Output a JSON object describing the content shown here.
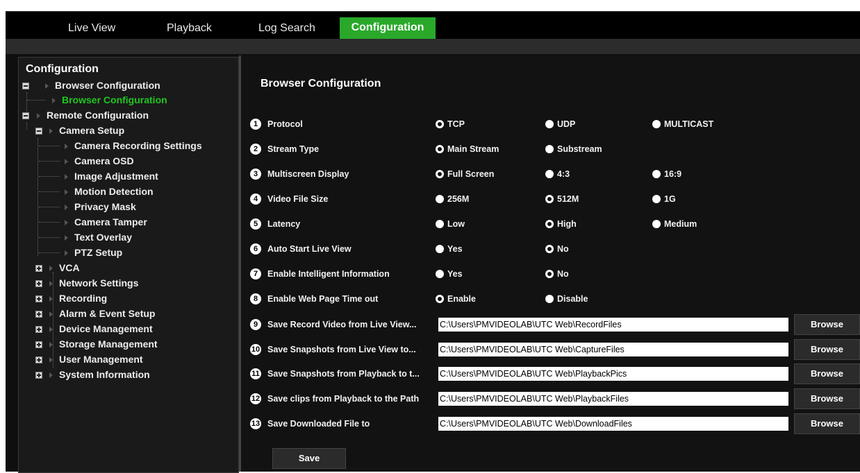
{
  "tabs": [
    {
      "label": "Live View"
    },
    {
      "label": "Playback"
    },
    {
      "label": "Log Search"
    },
    {
      "label": "Configuration",
      "active": true
    }
  ],
  "sidebar": {
    "title": "Configuration",
    "items": [
      {
        "label": "Browser Configuration",
        "expander": "minus"
      },
      {
        "label": "Browser Configuration",
        "selected": true
      },
      {
        "label": "Remote Configuration",
        "expander": "minus"
      },
      {
        "label": "Camera Setup",
        "expander": "minus"
      },
      {
        "label": "Camera Recording Settings"
      },
      {
        "label": "Camera OSD"
      },
      {
        "label": "Image Adjustment"
      },
      {
        "label": "Motion Detection"
      },
      {
        "label": "Privacy Mask"
      },
      {
        "label": "Camera Tamper"
      },
      {
        "label": "Text Overlay"
      },
      {
        "label": "PTZ Setup"
      },
      {
        "label": "VCA",
        "expander": "plus"
      },
      {
        "label": "Network Settings",
        "expander": "plus"
      },
      {
        "label": "Recording",
        "expander": "plus"
      },
      {
        "label": "Alarm & Event Setup",
        "expander": "plus"
      },
      {
        "label": "Device Management",
        "expander": "plus"
      },
      {
        "label": "Storage Management",
        "expander": "plus"
      },
      {
        "label": "User Management",
        "expander": "plus"
      },
      {
        "label": "System Information",
        "expander": "plus"
      }
    ]
  },
  "main": {
    "title": "Browser Configuration",
    "settings": [
      {
        "num": "1",
        "label": "Protocol",
        "options": [
          {
            "label": "TCP",
            "selected": true
          },
          {
            "label": "UDP"
          },
          {
            "label": "MULTICAST"
          }
        ]
      },
      {
        "num": "2",
        "label": "Stream Type",
        "options": [
          {
            "label": "Main Stream",
            "selected": true
          },
          {
            "label": "Substream"
          }
        ]
      },
      {
        "num": "3",
        "label": "Multiscreen Display",
        "options": [
          {
            "label": "Full Screen",
            "selected": true
          },
          {
            "label": "4:3"
          },
          {
            "label": "16:9"
          }
        ]
      },
      {
        "num": "4",
        "label": "Video File Size",
        "options": [
          {
            "label": "256M"
          },
          {
            "label": "512M",
            "selected": true
          },
          {
            "label": "1G"
          }
        ]
      },
      {
        "num": "5",
        "label": "Latency",
        "options": [
          {
            "label": "Low"
          },
          {
            "label": "High",
            "selected": true
          },
          {
            "label": "Medium"
          }
        ]
      },
      {
        "num": "6",
        "label": "Auto Start Live View",
        "options": [
          {
            "label": "Yes"
          },
          {
            "label": "No",
            "selected": true
          }
        ]
      },
      {
        "num": "7",
        "label": "Enable Intelligent Information",
        "options": [
          {
            "label": "Yes"
          },
          {
            "label": "No",
            "selected": true
          }
        ]
      },
      {
        "num": "8",
        "label": "Enable Web Page Time out",
        "options": [
          {
            "label": "Enable",
            "selected": true
          },
          {
            "label": "Disable"
          }
        ]
      }
    ],
    "paths": [
      {
        "num": "9",
        "label": "Save Record Video from Live View...",
        "value": "C:\\Users\\PMVIDEOLAB\\UTC Web\\RecordFiles",
        "button": "Browse"
      },
      {
        "num": "10",
        "label": "Save Snapshots from Live View to...",
        "value": "C:\\Users\\PMVIDEOLAB\\UTC Web\\CaptureFiles",
        "button": "Browse"
      },
      {
        "num": "11",
        "label": "Save Snapshots from Playback to t...",
        "value": "C:\\Users\\PMVIDEOLAB\\UTC Web\\PlaybackPics",
        "button": "Browse"
      },
      {
        "num": "12",
        "label": "Save clips from Playback to the Path",
        "value": "C:\\Users\\PMVIDEOLAB\\UTC Web\\PlaybackFiles",
        "button": "Browse"
      },
      {
        "num": "13",
        "label": "Save Downloaded File to",
        "value": "C:\\Users\\PMVIDEOLAB\\UTC Web\\DownloadFiles",
        "button": "Browse"
      }
    ],
    "save_label": "Save"
  }
}
